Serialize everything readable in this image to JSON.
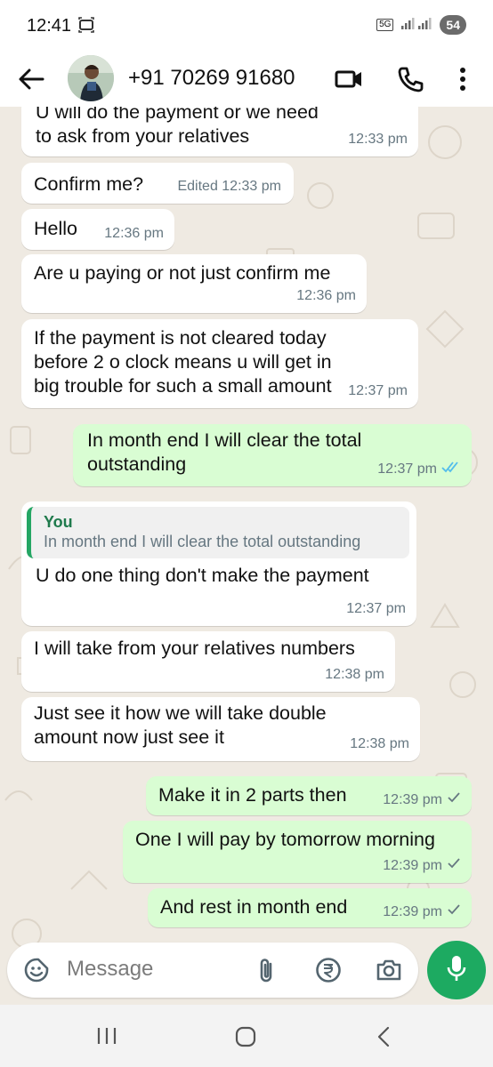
{
  "status_bar": {
    "time": "12:41",
    "network": "5G",
    "battery": "54"
  },
  "header": {
    "contact": "+91 70269 91680"
  },
  "messages": [
    {
      "dir": "in",
      "text": "U will do the payment or we need to ask from your relatives",
      "time": "12:33 pm"
    },
    {
      "dir": "in",
      "text": "Confirm me?",
      "time": "Edited 12:33 pm"
    },
    {
      "dir": "in",
      "text": "Hello",
      "time": "12:36 pm"
    },
    {
      "dir": "in",
      "text": "Are u paying or not just confirm me",
      "time": "12:36 pm"
    },
    {
      "dir": "in",
      "text": "If the payment is not cleared today before 2 o clock means u will get in big trouble for such a small amount",
      "time": "12:37 pm"
    },
    {
      "dir": "out",
      "text": "In month end I will clear the total outstanding",
      "time": "12:37 pm",
      "status": "read"
    },
    {
      "dir": "in",
      "quote_author": "You",
      "quote_text": "In month end I will clear the total outstanding",
      "text": "U do one thing don't make the payment",
      "time": "12:37 pm"
    },
    {
      "dir": "in",
      "text": "I will take from your relatives numbers",
      "time": "12:38 pm"
    },
    {
      "dir": "in",
      "text": "Just see it how we will take double amount now just see it",
      "time": "12:38 pm"
    },
    {
      "dir": "out",
      "text": "Make it in 2 parts then",
      "time": "12:39 pm",
      "status": "sent"
    },
    {
      "dir": "out",
      "text": "One I will pay by tomorrow morning",
      "time": "12:39 pm",
      "status": "sent"
    },
    {
      "dir": "out",
      "text": "And rest in month end",
      "time": "12:39 pm",
      "status": "sent"
    }
  ],
  "composer": {
    "placeholder": "Message"
  },
  "colors": {
    "incoming": "#ffffff",
    "outgoing": "#d9fdd3",
    "wallpaper": "#efeae2",
    "accent": "#1daa61",
    "read_tick": "#53bdeb"
  },
  "icons": [
    "back-arrow-icon",
    "video-call-icon",
    "phone-icon",
    "more-options-icon",
    "emoji-sticker-icon",
    "attach-icon",
    "rupee-payment-icon",
    "camera-icon",
    "mic-icon"
  ]
}
